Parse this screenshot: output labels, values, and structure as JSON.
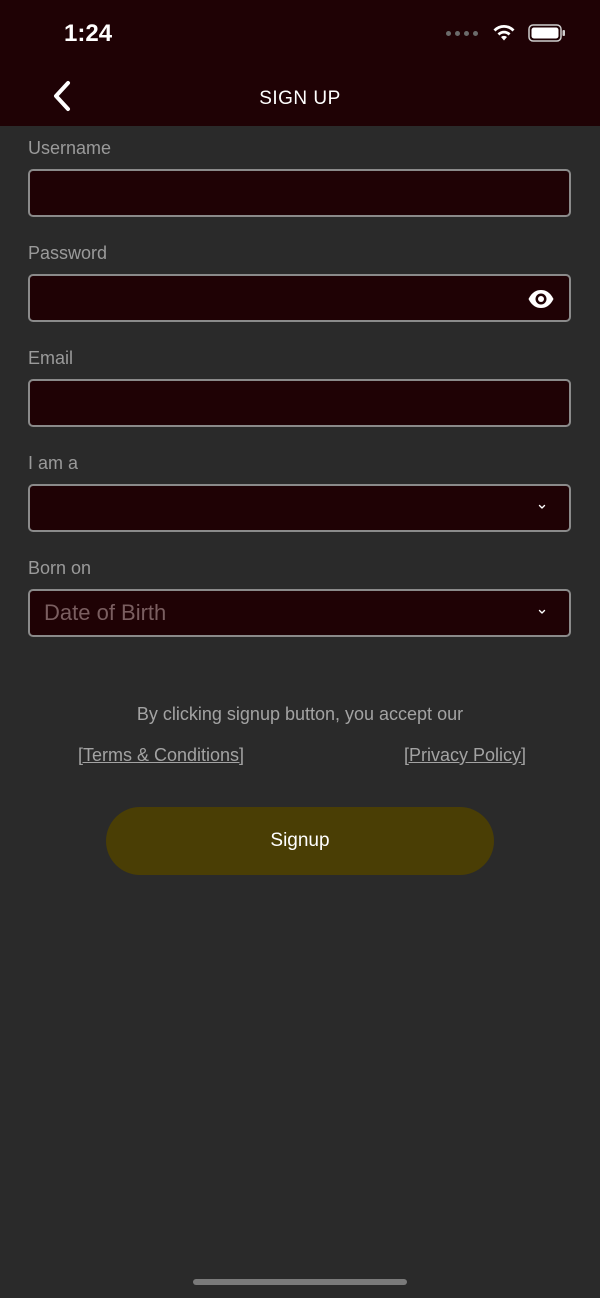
{
  "status_bar": {
    "time": "1:24",
    "wifi_icon": "wifi-icon",
    "battery_icon": "battery-icon"
  },
  "nav": {
    "title": "SIGN UP",
    "back_icon": "chevron-left-icon"
  },
  "form": {
    "username": {
      "label": "Username",
      "value": ""
    },
    "password": {
      "label": "Password",
      "value": "",
      "toggle_icon": "eye-icon"
    },
    "email": {
      "label": "Email",
      "value": ""
    },
    "role": {
      "label": "I am a",
      "value": "",
      "chevron_icon": "chevron-down-icon"
    },
    "dob": {
      "label": "Born on",
      "placeholder": "Date of Birth",
      "chevron_icon": "chevron-down-icon"
    }
  },
  "legal": {
    "accept_text": "By clicking signup button, you accept our",
    "terms_link": "[Terms & Conditions]",
    "privacy_link": "[Privacy Policy]"
  },
  "actions": {
    "signup_label": "Signup"
  },
  "colors": {
    "background": "#2a2a2a",
    "header": "#1f0205",
    "field_fill": "#1f0205",
    "field_border": "#8a8a8a",
    "button": "#4a3e05",
    "muted_text": "#9a9a9a"
  }
}
